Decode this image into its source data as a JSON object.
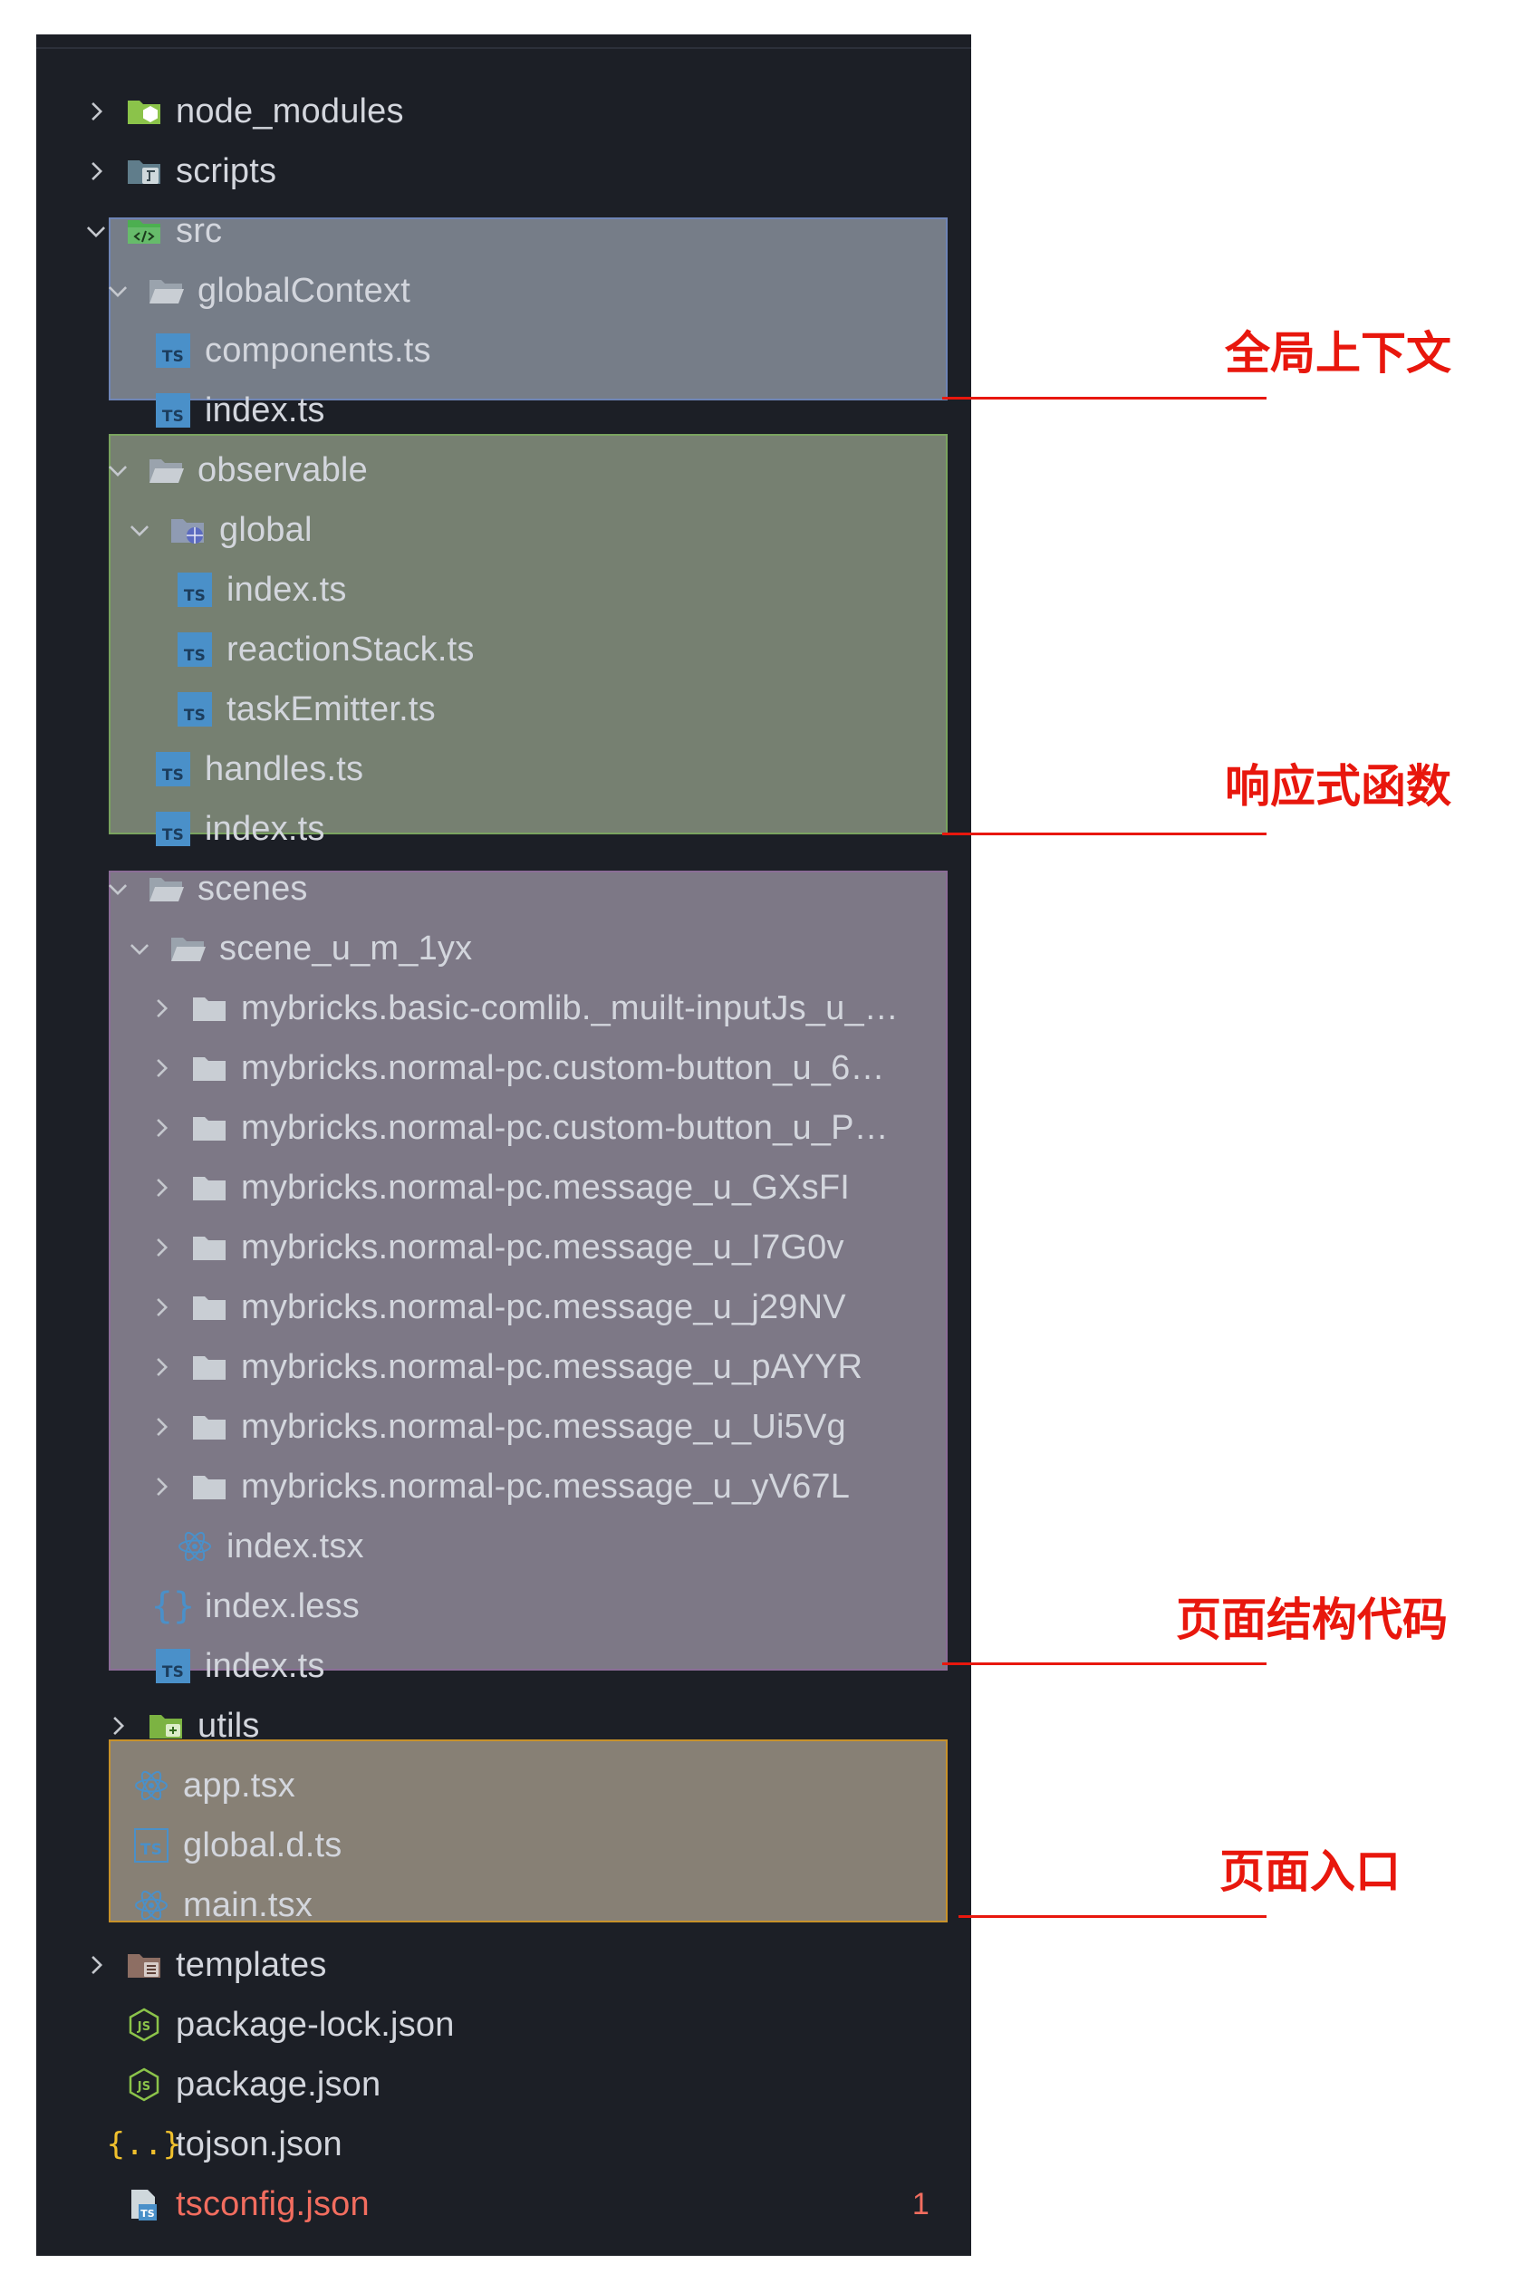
{
  "tree": {
    "node_modules": "node_modules",
    "scripts": "scripts",
    "src": "src",
    "globalContext": "globalContext",
    "components_ts": "components.ts",
    "ctx_index_ts": "index.ts",
    "observable": "observable",
    "global": "global",
    "global_index_ts": "index.ts",
    "reactionStack_ts": "reactionStack.ts",
    "taskEmitter_ts": "taskEmitter.ts",
    "handles_ts": "handles.ts",
    "obs_index_ts": "index.ts",
    "scenes": "scenes",
    "scene_folder": "scene_u_m_1yx",
    "scene_items": [
      "mybricks.basic-comlib._muilt-inputJs_u_…",
      "mybricks.normal-pc.custom-button_u_6…",
      "mybricks.normal-pc.custom-button_u_P…",
      "mybricks.normal-pc.message_u_GXsFI",
      "mybricks.normal-pc.message_u_I7G0v",
      "mybricks.normal-pc.message_u_j29NV",
      "mybricks.normal-pc.message_u_pAYYR",
      "mybricks.normal-pc.message_u_Ui5Vg",
      "mybricks.normal-pc.message_u_yV67L"
    ],
    "scene_index_tsx": "index.tsx",
    "scenes_index_less": "index.less",
    "scenes_index_ts": "index.ts",
    "utils": "utils",
    "app_tsx": "app.tsx",
    "global_d_ts": "global.d.ts",
    "main_tsx": "main.tsx",
    "templates": "templates",
    "package_lock_json": "package-lock.json",
    "package_json": "package.json",
    "tojson_json": "tojson.json",
    "tsconfig_json": "tsconfig.json",
    "tsconfig_problems": "1"
  },
  "annotations": {
    "global_context": "全局上下文",
    "reactive_functions": "响应式函数",
    "page_structure_code": "页面结构代码",
    "page_entry": "页面入口"
  },
  "colors": {
    "panel_bg": "#1c1f26",
    "context_region": "#767d88",
    "observable_region": "#768071",
    "scenes_region": "#7d7886",
    "entry_region": "#878075",
    "annotation_red": "#e8170d",
    "error_text": "#f26d5f",
    "ts_blue": "#4a90c9"
  },
  "icons": {
    "node_modules": "folder-node-icon",
    "scripts": "folder-scripts-icon",
    "src": "folder-src-icon",
    "folder": "folder-icon",
    "global": "folder-global-icon",
    "ts": "typescript-file-icon",
    "tsx": "react-icon",
    "less": "braces-icon",
    "json": "json-icon",
    "utils": "folder-utils-icon",
    "templates": "folder-templates-icon",
    "tsconfig": "tsconfig-icon"
  }
}
